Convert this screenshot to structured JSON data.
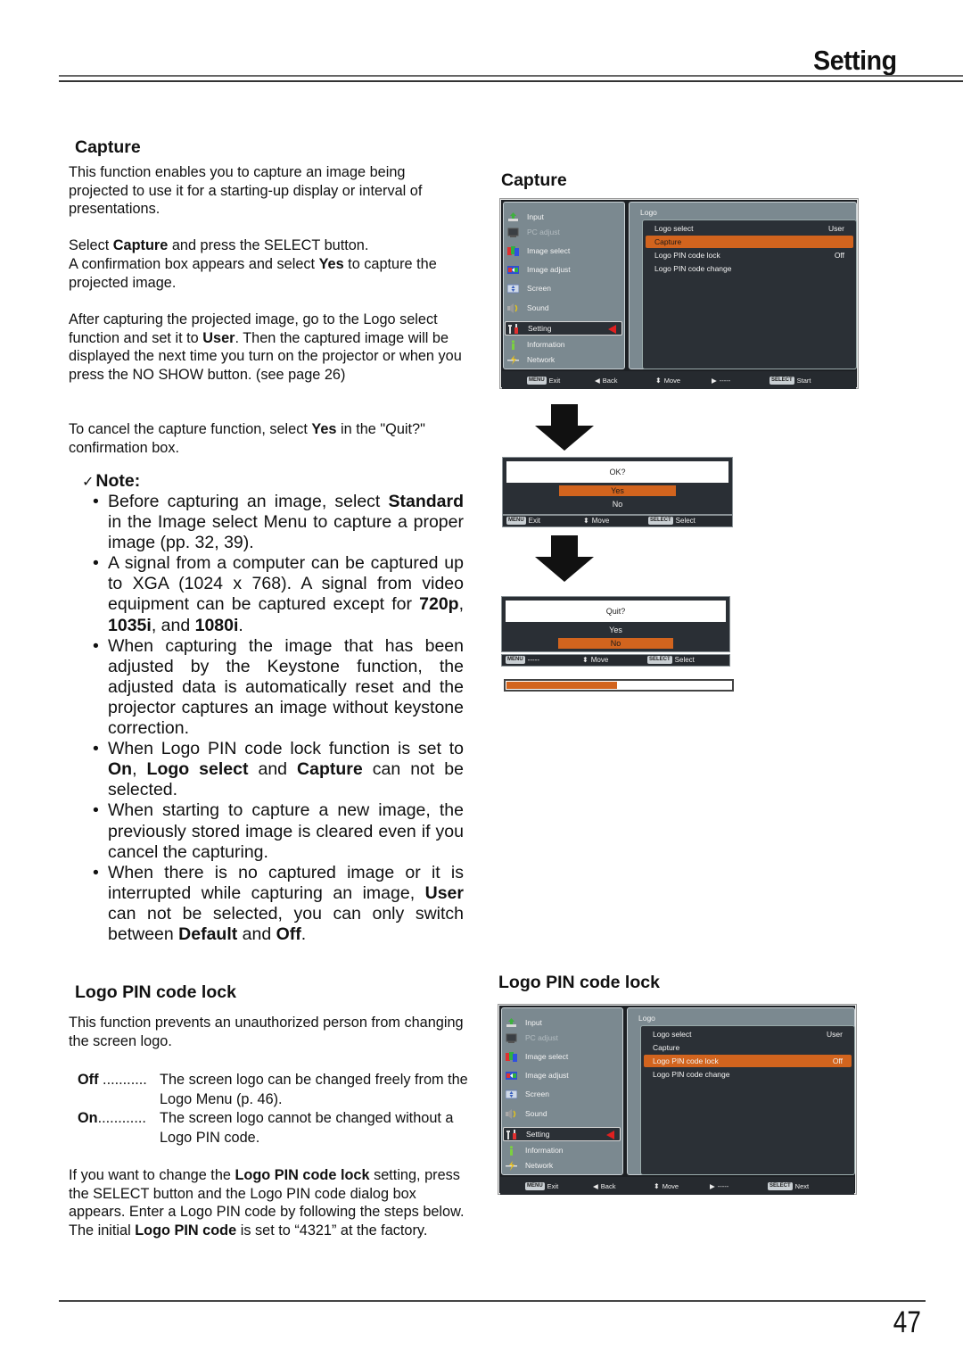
{
  "header": {
    "title": "Setting"
  },
  "capture_section": {
    "title": "Capture",
    "paragraphs": [
      [
        {
          "t": "This function enables you to capture an image being projected to use it for a starting-up display or interval of presentations."
        }
      ],
      [
        {
          "t": "Select "
        },
        {
          "b": "Capture"
        },
        {
          "t": " and press the SELECT button."
        }
      ],
      [
        {
          "t": "A confirmation box appears and select "
        },
        {
          "b": "Yes"
        },
        {
          "t": " to capture the projected image."
        }
      ],
      [
        {
          "t": "After capturing the projected image, go to the Logo select function and set it to "
        },
        {
          "b": "User"
        },
        {
          "t": ". Then the captured image will be displayed the next time you turn on the projector or when you press the NO SHOW button. (see page 26)"
        }
      ],
      [
        {
          "t": "To cancel the capture function, select "
        },
        {
          "b": "Yes"
        },
        {
          "t": " in the \"Quit?\" confirmation box."
        }
      ]
    ]
  },
  "note": {
    "title": "Note:",
    "check_glyph": "✓",
    "items": [
      [
        {
          "t": "Before capturing an image, select "
        },
        {
          "b": "Standard"
        },
        {
          "t": " in the Image select Menu to capture a proper image (pp. 32, 39)."
        }
      ],
      [
        {
          "t": "A signal from a computer can be captured up to XGA (1024 x 768). A signal from video equipment can be captured except for "
        },
        {
          "b": "720p"
        },
        {
          "t": ", "
        },
        {
          "b": "1035i"
        },
        {
          "t": ", and "
        },
        {
          "b": "1080i"
        },
        {
          "t": "."
        }
      ],
      [
        {
          "t": "When capturing the image that has been adjusted by the Keystone function, the adjusted data is automatically reset and the projector captures an image without keystone correction."
        }
      ],
      [
        {
          "t": "When Logo PIN code lock function is set to "
        },
        {
          "b": "On"
        },
        {
          "t": ", "
        },
        {
          "b": "Logo select"
        },
        {
          "t": " and "
        },
        {
          "b": "Capture"
        },
        {
          "t": " can not be selected."
        }
      ],
      [
        {
          "t": "When starting to capture a new image, the previously stored image is cleared even if you cancel the capturing."
        }
      ],
      [
        {
          "t": "When there is no captured image or it is interrupted while capturing an image, "
        },
        {
          "b": "User"
        },
        {
          "t": " can not be selected, you can only switch between "
        },
        {
          "b": "Default"
        },
        {
          "t": " and "
        },
        {
          "b": "Off"
        },
        {
          "t": "."
        }
      ]
    ]
  },
  "pin_section": {
    "title": "Logo PIN code lock",
    "intro": "This function prevents an unauthorized person from changing the screen logo.",
    "options": [
      {
        "term": "Off",
        "dots": " ...........",
        "desc": "The screen logo can be changed freely from the Logo Menu (p. 46)."
      },
      {
        "term": "On",
        "dots": "............",
        "desc": "The screen logo cannot be changed without a Logo PIN code."
      }
    ],
    "closing": [
      {
        "t": "If you want to change the "
      },
      {
        "b": "Logo PIN code lock"
      },
      {
        "t": " setting, press the SELECT button and the Logo PIN code dialog box appears. Enter a Logo PIN code by following the steps below. The initial "
      },
      {
        "b": "Logo PIN code"
      },
      {
        "t": " is set to “4321” at the factory."
      }
    ]
  },
  "right": {
    "capture_title": "Capture",
    "pin_title": "Logo PIN code lock"
  },
  "osd_menu": {
    "main_items": [
      {
        "label": "Input",
        "icon": "input-icon",
        "dim": false
      },
      {
        "label": "PC adjust",
        "icon": "pc-adjust-icon",
        "dim": true
      },
      {
        "label": "Image select",
        "icon": "image-select-icon",
        "dim": false
      },
      {
        "label": "Image adjust",
        "icon": "image-adjust-icon",
        "dim": false
      },
      {
        "label": "Screen",
        "icon": "screen-icon",
        "dim": false
      },
      {
        "label": "Sound",
        "icon": "sound-icon",
        "dim": false
      },
      {
        "label": "Setting",
        "icon": "setting-icon",
        "dim": false,
        "selected": true
      },
      {
        "label": "Information",
        "icon": "information-icon",
        "dim": false
      },
      {
        "label": "Network",
        "icon": "network-icon",
        "dim": false
      }
    ],
    "submenu_title": "Logo",
    "sub_items": [
      {
        "label": "Logo select",
        "value": "User"
      },
      {
        "label": "Capture",
        "value": ""
      },
      {
        "label": "Logo PIN code lock",
        "value": "Off"
      },
      {
        "label": "Logo PIN code change",
        "value": ""
      }
    ]
  },
  "osd_capture": {
    "highlighted_index": 1,
    "footer": {
      "menu_key": "MENU",
      "exit": "Exit",
      "back": "Back",
      "move": "Move",
      "right": "-----",
      "select_key": "SELECT",
      "action": "Start"
    }
  },
  "osd_pin": {
    "highlighted_index": 2,
    "footer": {
      "menu_key": "MENU",
      "exit": "Exit",
      "back": "Back",
      "move": "Move",
      "right": "-----",
      "select_key": "SELECT",
      "action": "Next"
    }
  },
  "dialog_ok": {
    "question": "OK?",
    "yes": "Yes",
    "no": "No",
    "selected": "Yes",
    "footer": {
      "menu_key": "MENU",
      "left": "Exit",
      "move": "Move",
      "select_key": "SELECT",
      "action": "Select"
    }
  },
  "dialog_quit": {
    "question": "Quit?",
    "yes": "Yes",
    "no": "No",
    "selected": "No",
    "footer": {
      "menu_key": "MENU",
      "left": "-----",
      "move": "Move",
      "select_key": "SELECT",
      "action": "Select"
    }
  },
  "capture_progress": {
    "fraction": 0.49
  },
  "colors": {
    "highlight": "#d2641e",
    "panel": "#7b8990",
    "dark": "#2b3036",
    "selection_arrow": "#e02020"
  },
  "page_number": "47"
}
